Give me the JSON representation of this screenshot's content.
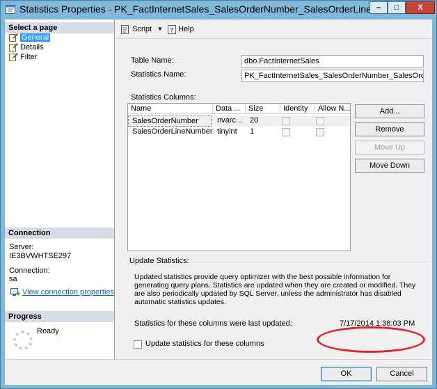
{
  "window": {
    "title": "Statistics Properties - PK_FactInternetSales_SalesOrderNumber_SalesOrderLineNumb...",
    "minimize_glyph": "–",
    "maximize_glyph": "□",
    "close_glyph": "X"
  },
  "left_pane": {
    "select_page_header": "Select a page",
    "pages": [
      {
        "label": "General",
        "selected": true,
        "icon": "page-wrench-icon"
      },
      {
        "label": "Details",
        "selected": false,
        "icon": "page-wrench-icon"
      },
      {
        "label": "Filter",
        "selected": false,
        "icon": "page-wrench-icon"
      }
    ],
    "connection_header": "Connection",
    "server_label": "Server:",
    "server_value": "IE3BVWHTSE297",
    "connection_label": "Connection:",
    "connection_value": "sa",
    "view_connection_link": "View connection properties",
    "progress_header": "Progress",
    "progress_status": "Ready"
  },
  "toolbar": {
    "script_label": "Script",
    "help_label": "Help"
  },
  "form": {
    "table_name_label": "Table Name:",
    "table_name_value": "dbo.FactInternetSales",
    "statistics_name_label": "Statistics Name:",
    "statistics_name_value": "PK_FactInternetSales_SalesOrderNumber_SalesOrderLineNu",
    "statistics_columns_label": "Statistics Columns:",
    "columns_headers": [
      "Name",
      "Data ...",
      "Size",
      "Identity",
      "Allow N..."
    ],
    "columns_rows": [
      {
        "name": "SalesOrderNumber",
        "data_type": "nvarc...",
        "size": "20",
        "identity": false,
        "allow_nulls": false
      },
      {
        "name": "SalesOrderLineNumber",
        "data_type": "tinyint",
        "size": "1",
        "identity": false,
        "allow_nulls": false
      }
    ],
    "buttons": {
      "add": "Add...",
      "remove": "Remove",
      "move_up": "Move Up",
      "move_down": "Move Down"
    },
    "update_statistics_header": "Update Statistics:",
    "update_description": "Updated statistics provide query optimizer with the best possible information for generating query plans. Statistics are updated when they are created or modified. They are also periodically updated by SQL Server, unless the administrator has disabled automatic statistics updates.",
    "last_updated_label": "Statistics for these columns were last updated:",
    "last_updated_value": "7/17/2014 1:38:03 PM",
    "update_checkbox_label": "Update statistics for these columns",
    "update_checkbox_checked": false
  },
  "footer": {
    "ok_label": "OK",
    "cancel_label": "Cancel"
  },
  "colors": {
    "title_bar": "#7fb8d9",
    "selection": "#3399ff",
    "link": "#0066cc",
    "annotation": "#e0242a",
    "close_button": "#c7443a"
  }
}
